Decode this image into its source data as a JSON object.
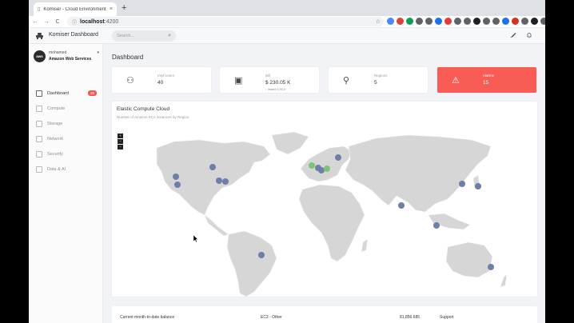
{
  "browser": {
    "tab_title": "Komiser - Cloud Environment",
    "tab_close": "×",
    "new_tab": "+",
    "url_host": "localhost",
    "url_port": ":4200",
    "nav_back": "←",
    "nav_forward": "→",
    "nav_reload": "C",
    "star": "☆",
    "extension_colors": [
      "#4a8af4",
      "#db4437",
      "#0f9d58",
      "#5f6368",
      "#5f6368",
      "#1a73e8",
      "#e53935",
      "#5f6368",
      "#5f6368",
      "#202124",
      "#5f6368",
      "#5f6368",
      "#1a73e8",
      "#d93025",
      "#5f6368",
      "#202124",
      "#5f6368",
      "#8d6e63",
      "#d93025"
    ]
  },
  "app": {
    "brand": "Komiser Dashboard",
    "search_placeholder": "Search...",
    "search_icon": "⌕",
    "top_icons": [
      "rocket-icon",
      "bell-icon"
    ],
    "accent_color": "#ef5b53"
  },
  "account": {
    "badge": "aws",
    "user": "mohamed",
    "provider": "Amazon Web Services",
    "caret": "▾"
  },
  "sidebar": {
    "items": [
      {
        "label": "Dashboard",
        "badge": "25",
        "active": true
      },
      {
        "label": "Compute",
        "badge": "",
        "active": false
      },
      {
        "label": "Storage",
        "badge": "",
        "active": false
      },
      {
        "label": "Network",
        "badge": "",
        "active": false
      },
      {
        "label": "Security",
        "badge": "",
        "active": false
      },
      {
        "label": "Data & AI",
        "badge": "",
        "active": false
      }
    ]
  },
  "dashboard": {
    "title": "Dashboard",
    "cards": [
      {
        "label": "IAM Users",
        "value": "40",
        "sub": "",
        "icon": "users-icon",
        "glyph": "⚇"
      },
      {
        "label": "Bill",
        "value": "$ 230.05 K",
        "sub": "↑ Inward 0.2013",
        "icon": "bill-icon",
        "glyph": "▣"
      },
      {
        "label": "Regions",
        "value": "5",
        "sub": "",
        "icon": "location-icon",
        "glyph": "⚲"
      },
      {
        "label": "Alarms",
        "value": "15",
        "sub": "",
        "icon": "warning-icon",
        "glyph": "⚠"
      }
    ]
  },
  "map": {
    "title": "Elastic Compute Cloud",
    "subtitle": "Number of Amazon EC2 instances by Region",
    "zoom_controls": [
      "+",
      "−",
      "−"
    ],
    "marker_colors": {
      "default": "#6d7ea8",
      "highlight": "#7ac47a"
    },
    "land_color": "#d6d6d6"
  },
  "bottom": {
    "left_label": "Current month-to-date balance",
    "mid_label": "EC2 - Other",
    "mid_value": "81,856.685",
    "right_label": "Support"
  }
}
